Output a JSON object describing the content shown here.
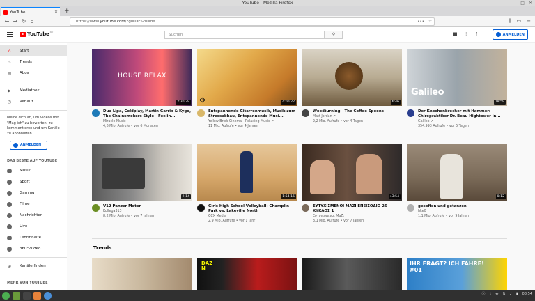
{
  "window": {
    "title": "YouTube - Mozilla Firefox"
  },
  "browser": {
    "tab_title": "YouTube",
    "url_prefix": "https://www.",
    "url_domain": "youtube.com",
    "url_rest": "/?gl=DE&hl=de"
  },
  "header": {
    "logo_text": "YouTube",
    "logo_country": "DE",
    "search_placeholder": "Suchen",
    "signin_label": "ANMELDEN"
  },
  "sidebar": {
    "main": [
      {
        "label": "Start",
        "icon": "home-icon"
      },
      {
        "label": "Trends",
        "icon": "flame-icon"
      },
      {
        "label": "Abos",
        "icon": "subscriptions-icon"
      }
    ],
    "library": [
      {
        "label": "Mediathek",
        "icon": "library-icon"
      },
      {
        "label": "Verlauf",
        "icon": "history-icon"
      }
    ],
    "signin_prompt": "Melde dich an, um Videos mit \"Mag ich\" zu bewerten, zu kommentieren und um Kanäle zu abonnieren",
    "signin_label": "ANMELDEN",
    "best_heading": "DAS BESTE AUF YOUTUBE",
    "categories": [
      "Musik",
      "Sport",
      "Gaming",
      "Filme",
      "Nachrichten",
      "Live",
      "Lehrinhalte",
      "360°-Video"
    ],
    "channels_label": "Kanäle finden",
    "more_heading": "MEHR VON YOUTUBE"
  },
  "videos": [
    {
      "title": "Dua Lipa, Coldplay, Martin Garrix & Kygo, The Chainsmokers Style - Feelin...",
      "channel": "Miracle Music",
      "stats": "4,6 Mio. Aufrufe • vor 6 Monaten",
      "duration": "2:30:29",
      "thumb_text": "HOUSE  RELAX"
    },
    {
      "title": "Entspannende Gitarrenmusik, Musik zum Stressabbau, Entspannende Musi...",
      "channel": "Yellow Brick Cinema - Relaxing Music ✔",
      "stats": "11 Mio. Aufrufe • vor 4 Jahren",
      "duration": "4:00:22",
      "thumb_text": ""
    },
    {
      "title": "Woodturning - The Coffee Spoons",
      "channel": "Matt Jordan ✔",
      "stats": "2,2 Mio. Aufrufe • vor 4 Tagen",
      "duration": "6:46",
      "thumb_text": ""
    },
    {
      "title": "Der Knochenbrecher mit Hammer: Chiropraktiker Dr. Beau Hightower in...",
      "channel": "Galileo ✔",
      "stats": "354.993 Aufrufe • vor 5 Tagen",
      "duration": "18:59",
      "thumb_text": "Galileo"
    },
    {
      "title": "V12 Panzer Motor",
      "channel": "Kollega313",
      "stats": "8,2 Mio. Aufrufe • vor 7 Jahren",
      "duration": "2:14",
      "thumb_text": ""
    },
    {
      "title": "Girls High School Volleyball: Champlin Park vs. Lakeville North",
      "channel": "CCX Media",
      "stats": "2,9 Mio. Aufrufe • vor 1 Jahr",
      "duration": "1:54:15",
      "thumb_text": ""
    },
    {
      "title": "ΕΥΤΥΧΙΣΜΕΝΟΙ ΜΑΖΙ ΕΠΕΙΣΟΔΙΟ 25 ΚΥΚΛΟΣ 1",
      "channel": "Ευτυχισμενοι Μαζι",
      "stats": "3,1 Mio. Aufrufe • vor 7 Jahren",
      "duration": "43:54",
      "thumb_text": ""
    },
    {
      "title": "gesoffen und getanzen",
      "channel": "hke0",
      "stats": "1,1 Mio. Aufrufe • vor 9 Jahren",
      "duration": "0:12",
      "thumb_text": ""
    }
  ],
  "trends": {
    "heading": "Trends",
    "thumbs": [
      {
        "text": ""
      },
      {
        "text": "DAZN"
      },
      {
        "text": ""
      },
      {
        "text": "IHR FRAGT? ICH FAHRE! #01"
      }
    ]
  },
  "taskbar": {
    "clock": "08:54"
  },
  "colors": {
    "accent": "#065fd4",
    "brand_red": "#ff0000"
  }
}
